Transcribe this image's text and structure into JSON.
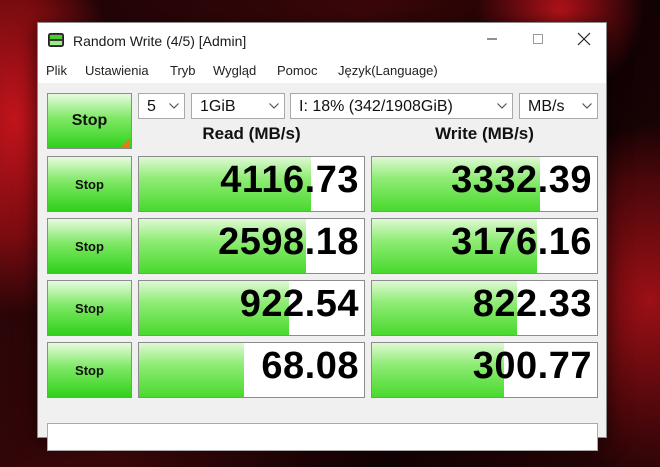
{
  "window": {
    "title": "Random Write (4/5) [Admin]"
  },
  "menu": [
    "Plik",
    "Ustawienia",
    "Tryb",
    "Wygląd",
    "Pomoc",
    "Język(Language)"
  ],
  "toolbar": {
    "main_button": "Stop",
    "count": "5",
    "size": "1GiB",
    "drive": "I: 18% (342/1908GiB)",
    "unit": "MB/s"
  },
  "headers": {
    "read": "Read (MB/s)",
    "write": "Write (MB/s)"
  },
  "rows": [
    {
      "button": "Stop",
      "read": "4116.73",
      "write": "3332.39",
      "read_fill": 0.765,
      "write_fill": 0.745
    },
    {
      "button": "Stop",
      "read": "2598.18",
      "write": "3176.16",
      "read_fill": 0.74,
      "write_fill": 0.735
    },
    {
      "button": "Stop",
      "read": "922.54",
      "write": "822.33",
      "read_fill": 0.665,
      "write_fill": 0.645
    },
    {
      "button": "Stop",
      "read": "68.08",
      "write": "300.77",
      "read_fill": 0.465,
      "write_fill": 0.585
    }
  ],
  "status": "",
  "icons": {
    "app": "crystaldiskmark-icon",
    "minimize": "minimize-icon",
    "maximize": "maximize-icon",
    "close": "close-icon",
    "dropdown": "chevron-down-icon"
  },
  "colors": {
    "bar_green": "#49d92e",
    "button_green": "#2fd11b",
    "corner_orange": "#e87b13"
  }
}
